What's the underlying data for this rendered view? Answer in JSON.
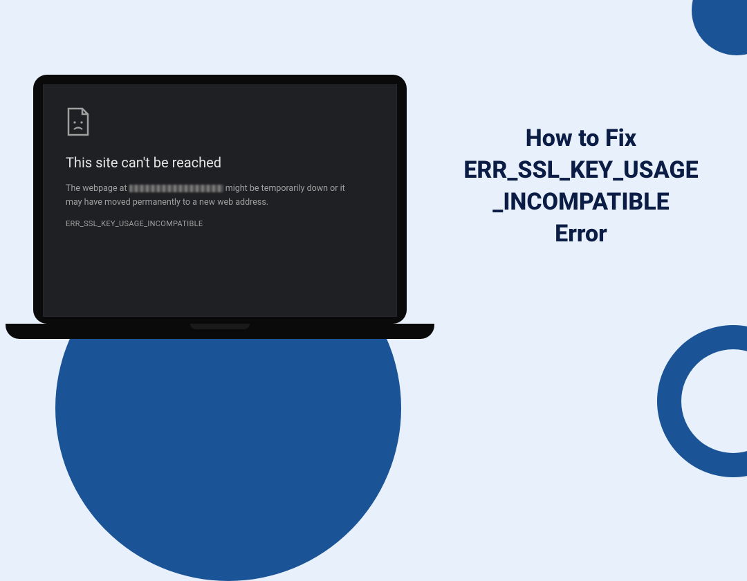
{
  "decor": {
    "colors": {
      "accent": "#1b5397",
      "page_bg": "#e8f0fc",
      "screen_bg": "#1f2023",
      "text_dark": "#0b1c45"
    }
  },
  "laptop": {
    "error": {
      "title": "This site can't be reached",
      "desc_prefix": "The webpage at ",
      "desc_suffix": " might be temporarily down or it may have moved permanently to a new web address.",
      "code": "ERR_SSL_KEY_USAGE_INCOMPATIBLE"
    }
  },
  "headline": {
    "line1": "How to Fix",
    "line2": "ERR_SSL_KEY_USAGE",
    "line3": "_INCOMPATIBLE",
    "line4": "Error"
  }
}
